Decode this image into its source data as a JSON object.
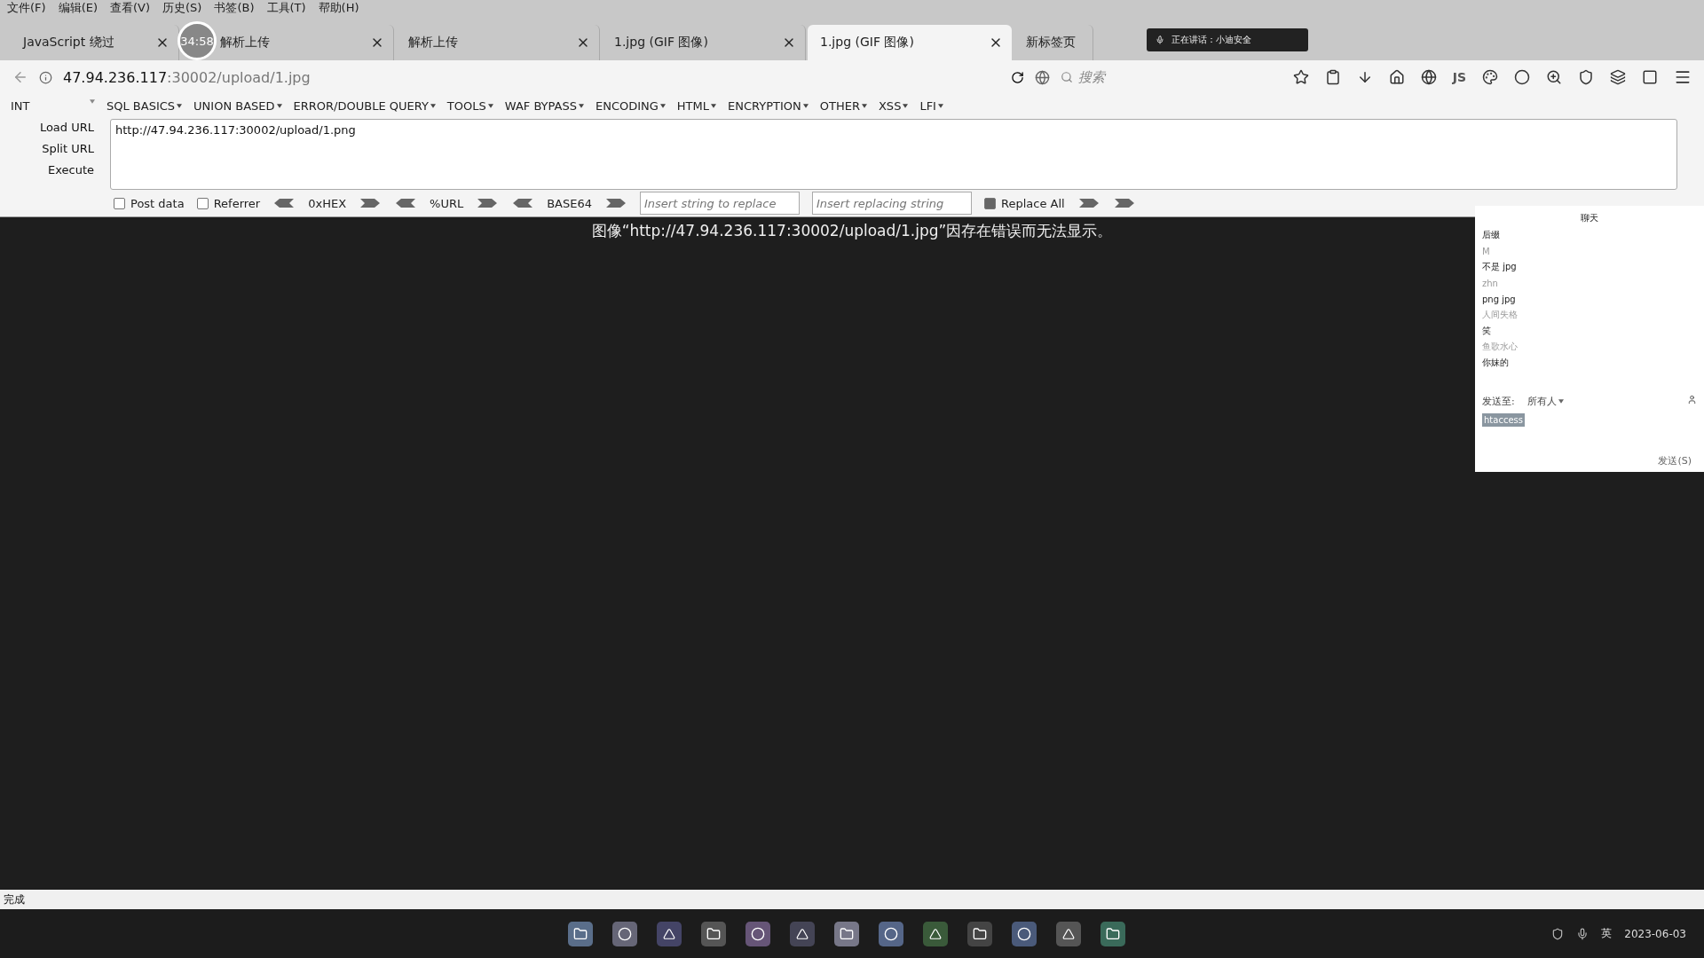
{
  "menu_bar": [
    "文件(F)",
    "编辑(E)",
    "查看(V)",
    "历史(S)",
    "书签(B)",
    "工具(T)",
    "帮助(H)"
  ],
  "timer": "34:58",
  "tabs": [
    {
      "label": "JavaScript 绕过",
      "selected": false,
      "closable": true
    },
    {
      "label": "解析上传",
      "selected": false,
      "closable": true
    },
    {
      "label": "解析上传",
      "selected": false,
      "closable": true
    },
    {
      "label": "1.jpg (GIF 图像)",
      "selected": false,
      "closable": true
    },
    {
      "label": "1.jpg (GIF 图像)",
      "selected": true,
      "closable": true
    },
    {
      "label": "新标签页",
      "selected": false,
      "closable": false
    }
  ],
  "speaking_banner": "正在讲话：小迪安全",
  "address_bar": {
    "host": "47.94.236.117",
    "rest": ":30002/upload/1.jpg",
    "search_placeholder": "搜索",
    "js_label": "JS"
  },
  "hackbar": {
    "type_select": "INT",
    "menus": [
      "SQL BASICS",
      "UNION BASED",
      "ERROR/DOUBLE QUERY",
      "TOOLS",
      "WAF BYPASS",
      "ENCODING",
      "HTML",
      "ENCRYPTION",
      "OTHER",
      "XSS",
      "LFI"
    ],
    "actions": [
      "Load URL",
      "Split URL",
      "Execute"
    ],
    "url_value": "http://47.94.236.117:30002/upload/1.png",
    "options": [
      {
        "label": "Post data",
        "checked": false
      },
      {
        "label": "Referrer",
        "checked": false
      }
    ],
    "encoders": [
      "0xHEX",
      "%URL",
      "BASE64"
    ],
    "replace_placeholder": "Insert string to replace",
    "replacing_placeholder": "Insert replacing string",
    "replace_all": {
      "label": "Replace All",
      "checked": true
    }
  },
  "content_message": "图像“http://47.94.236.117:30002/upload/1.jpg”因存在错误而无法显示。",
  "chat": {
    "title": "聊天",
    "messages": [
      {
        "kind": "message",
        "text": "后缀"
      },
      {
        "kind": "name",
        "text": "M"
      },
      {
        "kind": "message",
        "text": "不是 jpg"
      },
      {
        "kind": "name",
        "text": "zhn"
      },
      {
        "kind": "message",
        "text": "png jpg"
      },
      {
        "kind": "name",
        "text": "人间失格"
      },
      {
        "kind": "message",
        "text": "笑"
      },
      {
        "kind": "name",
        "text": "鱼歌水心"
      },
      {
        "kind": "message",
        "text": "你妹的"
      }
    ],
    "send_to_label": "发送至:",
    "send_to_value": "所有人",
    "input_value": "htaccess",
    "send_button": "发送(S)"
  },
  "status_bar": "完成",
  "taskbar": {
    "date": "2023-06-03",
    "ime": "英"
  }
}
